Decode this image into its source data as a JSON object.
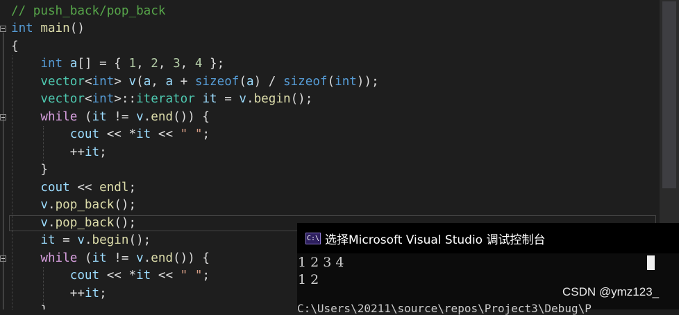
{
  "editor": {
    "lines": [
      {
        "tokens": [
          {
            "t": "// push_back/pop_back",
            "c": "cm"
          }
        ]
      },
      {
        "tokens": [
          {
            "t": "int",
            "c": "kw"
          },
          {
            "t": " ",
            "c": ""
          },
          {
            "t": "main",
            "c": "fn"
          },
          {
            "t": "()",
            "c": ""
          }
        ]
      },
      {
        "tokens": [
          {
            "t": "{",
            "c": ""
          }
        ]
      },
      {
        "tokens": [
          {
            "t": "    ",
            "c": ""
          },
          {
            "t": "int",
            "c": "kw"
          },
          {
            "t": " ",
            "c": ""
          },
          {
            "t": "a",
            "c": "var"
          },
          {
            "t": "[] = { ",
            "c": ""
          },
          {
            "t": "1",
            "c": "num"
          },
          {
            "t": ", ",
            "c": ""
          },
          {
            "t": "2",
            "c": "num"
          },
          {
            "t": ", ",
            "c": ""
          },
          {
            "t": "3",
            "c": "num"
          },
          {
            "t": ", ",
            "c": ""
          },
          {
            "t": "4",
            "c": "num"
          },
          {
            "t": " };",
            "c": ""
          }
        ]
      },
      {
        "tokens": [
          {
            "t": "    ",
            "c": ""
          },
          {
            "t": "vector",
            "c": "ty"
          },
          {
            "t": "<",
            "c": ""
          },
          {
            "t": "int",
            "c": "kw"
          },
          {
            "t": "> ",
            "c": ""
          },
          {
            "t": "v",
            "c": "var"
          },
          {
            "t": "(",
            "c": ""
          },
          {
            "t": "a",
            "c": "var"
          },
          {
            "t": ", ",
            "c": ""
          },
          {
            "t": "a",
            "c": "var"
          },
          {
            "t": " + ",
            "c": ""
          },
          {
            "t": "sizeof",
            "c": "kw"
          },
          {
            "t": "(",
            "c": ""
          },
          {
            "t": "a",
            "c": "var"
          },
          {
            "t": ") / ",
            "c": ""
          },
          {
            "t": "sizeof",
            "c": "kw"
          },
          {
            "t": "(",
            "c": ""
          },
          {
            "t": "int",
            "c": "kw"
          },
          {
            "t": "));",
            "c": ""
          }
        ]
      },
      {
        "tokens": [
          {
            "t": "    ",
            "c": ""
          },
          {
            "t": "vector",
            "c": "ty"
          },
          {
            "t": "<",
            "c": ""
          },
          {
            "t": "int",
            "c": "kw"
          },
          {
            "t": ">::",
            "c": ""
          },
          {
            "t": "iterator",
            "c": "ty"
          },
          {
            "t": " ",
            "c": ""
          },
          {
            "t": "it",
            "c": "var"
          },
          {
            "t": " = ",
            "c": ""
          },
          {
            "t": "v",
            "c": "var"
          },
          {
            "t": ".",
            "c": ""
          },
          {
            "t": "begin",
            "c": "fn"
          },
          {
            "t": "();",
            "c": ""
          }
        ]
      },
      {
        "tokens": [
          {
            "t": "    ",
            "c": ""
          },
          {
            "t": "while",
            "c": "ctl"
          },
          {
            "t": " (",
            "c": ""
          },
          {
            "t": "it",
            "c": "var"
          },
          {
            "t": " != ",
            "c": ""
          },
          {
            "t": "v",
            "c": "var"
          },
          {
            "t": ".",
            "c": ""
          },
          {
            "t": "end",
            "c": "fn"
          },
          {
            "t": "()) {",
            "c": ""
          }
        ]
      },
      {
        "tokens": [
          {
            "t": "        ",
            "c": ""
          },
          {
            "t": "cout",
            "c": "var"
          },
          {
            "t": " << *",
            "c": ""
          },
          {
            "t": "it",
            "c": "var"
          },
          {
            "t": " << ",
            "c": ""
          },
          {
            "t": "\" \"",
            "c": "str"
          },
          {
            "t": ";",
            "c": ""
          }
        ]
      },
      {
        "tokens": [
          {
            "t": "        ++",
            "c": ""
          },
          {
            "t": "it",
            "c": "var"
          },
          {
            "t": ";",
            "c": ""
          }
        ]
      },
      {
        "tokens": [
          {
            "t": "    }",
            "c": ""
          }
        ]
      },
      {
        "tokens": [
          {
            "t": "    ",
            "c": ""
          },
          {
            "t": "cout",
            "c": "var"
          },
          {
            "t": " << ",
            "c": ""
          },
          {
            "t": "endl",
            "c": "fn"
          },
          {
            "t": ";",
            "c": ""
          }
        ]
      },
      {
        "tokens": [
          {
            "t": "    ",
            "c": ""
          },
          {
            "t": "v",
            "c": "var"
          },
          {
            "t": ".",
            "c": ""
          },
          {
            "t": "pop_back",
            "c": "fn"
          },
          {
            "t": "();",
            "c": ""
          }
        ]
      },
      {
        "tokens": [
          {
            "t": "    ",
            "c": ""
          },
          {
            "t": "v",
            "c": "var"
          },
          {
            "t": ".",
            "c": ""
          },
          {
            "t": "pop_back",
            "c": "fn"
          },
          {
            "t": "();",
            "c": ""
          }
        ]
      },
      {
        "tokens": [
          {
            "t": "    ",
            "c": ""
          },
          {
            "t": "it",
            "c": "var"
          },
          {
            "t": " = ",
            "c": ""
          },
          {
            "t": "v",
            "c": "var"
          },
          {
            "t": ".",
            "c": ""
          },
          {
            "t": "begin",
            "c": "fn"
          },
          {
            "t": "();",
            "c": ""
          }
        ]
      },
      {
        "tokens": [
          {
            "t": "    ",
            "c": ""
          },
          {
            "t": "while",
            "c": "ctl"
          },
          {
            "t": " (",
            "c": ""
          },
          {
            "t": "it",
            "c": "var"
          },
          {
            "t": " != ",
            "c": ""
          },
          {
            "t": "v",
            "c": "var"
          },
          {
            "t": ".",
            "c": ""
          },
          {
            "t": "end",
            "c": "fn"
          },
          {
            "t": "()) {",
            "c": ""
          }
        ]
      },
      {
        "tokens": [
          {
            "t": "        ",
            "c": ""
          },
          {
            "t": "cout",
            "c": "var"
          },
          {
            "t": " << *",
            "c": ""
          },
          {
            "t": "it",
            "c": "var"
          },
          {
            "t": " << ",
            "c": ""
          },
          {
            "t": "\" \"",
            "c": "str"
          },
          {
            "t": ";",
            "c": ""
          }
        ]
      },
      {
        "tokens": [
          {
            "t": "        ++",
            "c": ""
          },
          {
            "t": "it",
            "c": "var"
          },
          {
            "t": ";",
            "c": ""
          }
        ]
      },
      {
        "tokens": [
          {
            "t": "    }",
            "c": ""
          }
        ]
      }
    ]
  },
  "console": {
    "icon_label": "C:\\",
    "title": "选择Microsoft Visual Studio 调试控制台",
    "output_lines": [
      "1 2 3 4",
      "1 2"
    ],
    "path_partial": "C:\\Users\\20211\\source\\repos\\Project3\\Debug\\P"
  },
  "watermark": "CSDN @ymz123_"
}
